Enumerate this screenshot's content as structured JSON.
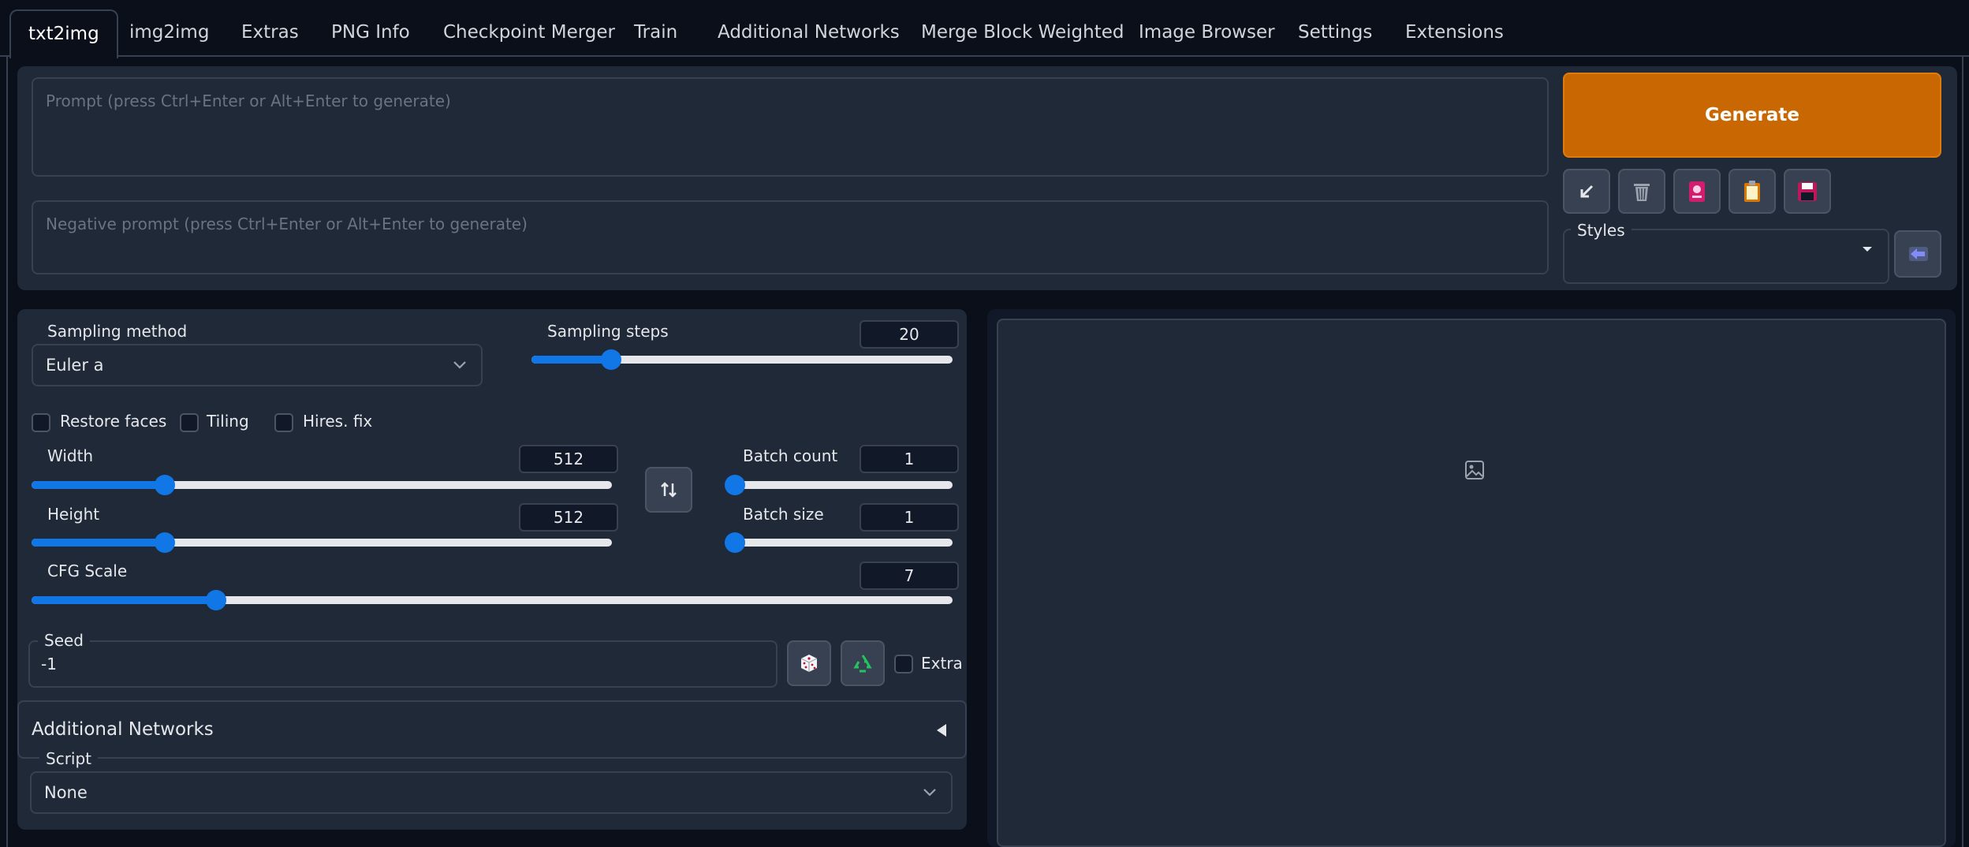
{
  "tabs": [
    {
      "label": "txt2img",
      "active": true
    },
    {
      "label": "img2img"
    },
    {
      "label": "Extras"
    },
    {
      "label": "PNG Info"
    },
    {
      "label": "Checkpoint Merger"
    },
    {
      "label": "Train"
    },
    {
      "label": "Additional Networks"
    },
    {
      "label": "Merge Block Weighted"
    },
    {
      "label": "Image Browser"
    },
    {
      "label": "Settings"
    },
    {
      "label": "Extensions"
    }
  ],
  "prompt": {
    "placeholder": "Prompt (press Ctrl+Enter or Alt+Enter to generate)",
    "value": ""
  },
  "negative_prompt": {
    "placeholder": "Negative prompt (press Ctrl+Enter or Alt+Enter to generate)",
    "value": ""
  },
  "generate": {
    "label": "Generate"
  },
  "tool_icons": [
    "arrow-down-left-icon",
    "trash-icon",
    "red-card-icon",
    "clipboard-icon",
    "floppy-disk-icon"
  ],
  "styles": {
    "label": "Styles",
    "value": ""
  },
  "sampling": {
    "method_label": "Sampling method",
    "method_value": "Euler a",
    "steps_label": "Sampling steps",
    "steps_value": "20"
  },
  "checks": {
    "restore_faces": "Restore faces",
    "tiling": "Tiling",
    "hires": "Hires. fix"
  },
  "width": {
    "label": "Width",
    "value": "512"
  },
  "height": {
    "label": "Height",
    "value": "512"
  },
  "batch_count": {
    "label": "Batch count",
    "value": "1"
  },
  "batch_size": {
    "label": "Batch size",
    "value": "1"
  },
  "cfg": {
    "label": "CFG Scale",
    "value": "7"
  },
  "seed": {
    "label": "Seed",
    "value": "-1",
    "extra": "Extra"
  },
  "additional_networks": {
    "label": "Additional Networks"
  },
  "script": {
    "label": "Script",
    "value": "None"
  },
  "slider_levels": {
    "steps": 0.19,
    "width": 0.23,
    "height": 0.23,
    "batch_count": 0.0,
    "batch_size": 0.0,
    "cfg": 0.2
  },
  "colors": {
    "accent": "#1177e6",
    "generate": "#c96703",
    "background": "#0b0f19",
    "panel": "#1f2937"
  }
}
